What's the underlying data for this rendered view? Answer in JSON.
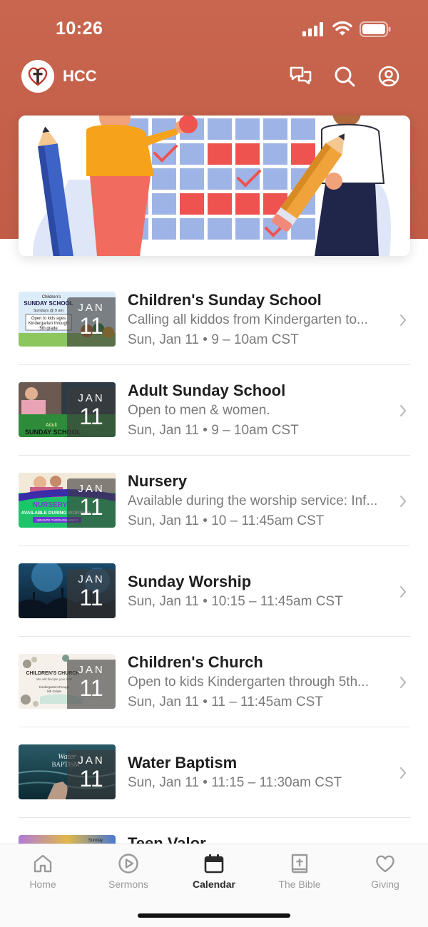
{
  "status_bar": {
    "time": "10:26"
  },
  "app_bar": {
    "title": "HCC",
    "icons": [
      "logo-cross-heart",
      "chat-icon",
      "search-icon",
      "profile-icon"
    ]
  },
  "hero": {
    "illustration": "calendar-planning-illustration"
  },
  "events": [
    {
      "title": "Children's Sunday School",
      "description": "Calling all kiddos from Kindergarten to...",
      "time": "Sun, Jan 11 • 9 – 10am CST",
      "month": "JAN",
      "day": "11",
      "thumb_text": [
        "Children's",
        "SUNDAY SCHOOL",
        "Sundays @ 9 am",
        "Open to kids ages",
        "Kindergarten through",
        "5th grade"
      ]
    },
    {
      "title": "Adult Sunday School",
      "description": "Open to men & women.",
      "time": "Sun, Jan 11 • 9 – 10am CST",
      "month": "JAN",
      "day": "11",
      "thumb_text": [
        "Adult",
        "SUNDAY SCHOOL"
      ]
    },
    {
      "title": "Nursery",
      "description": "Available during the worship service: Inf...",
      "time": "Sun, Jan 11 • 10 – 11:45am CST",
      "month": "JAN",
      "day": "11",
      "thumb_text": [
        "NURSERY",
        "AVAILABLE DURING WORSHIP",
        "INFANTS THROUGH AGE 3"
      ]
    },
    {
      "title": "Sunday Worship",
      "description": "",
      "time": "Sun, Jan 11 • 10:15 – 11:45am CST",
      "month": "JAN",
      "day": "11",
      "thumb_text": []
    },
    {
      "title": "Children's Church",
      "description": "Open to kids Kindergarten through 5th...",
      "time": "Sun, Jan 11 • 11 – 11:45am CST",
      "month": "JAN",
      "day": "11",
      "thumb_text": [
        "CHILDREN'S CHURCH",
        "We will disciple your kids",
        "Kindergarten through",
        "5th Grade"
      ]
    },
    {
      "title": "Water Baptism",
      "description": "",
      "time": "Sun, Jan 11 • 11:15 – 11:30am CST",
      "month": "JAN",
      "day": "11",
      "thumb_text": [
        "Water",
        "BAPTISM"
      ]
    },
    {
      "title": "Teen Valor",
      "description": "",
      "time": "",
      "month": "",
      "day": "",
      "thumb_text": [
        "Sunday"
      ]
    }
  ],
  "tabs": [
    {
      "label": "Home",
      "icon": "home-icon",
      "active": false
    },
    {
      "label": "Sermons",
      "icon": "play-icon",
      "active": false
    },
    {
      "label": "Calendar",
      "icon": "calendar-icon",
      "active": true
    },
    {
      "label": "The Bible",
      "icon": "bible-icon",
      "active": false
    },
    {
      "label": "Giving",
      "icon": "heart-icon",
      "active": false
    }
  ],
  "colors": {
    "header": "#c9664f",
    "accent_red": "#ef5350",
    "calendar_blue": "#9fb4e6",
    "text_primary": "#1f1f1f",
    "text_secondary": "#7a7a7a",
    "tab_active": "#2b2b2b",
    "tab_inactive": "#9a9a9a"
  }
}
